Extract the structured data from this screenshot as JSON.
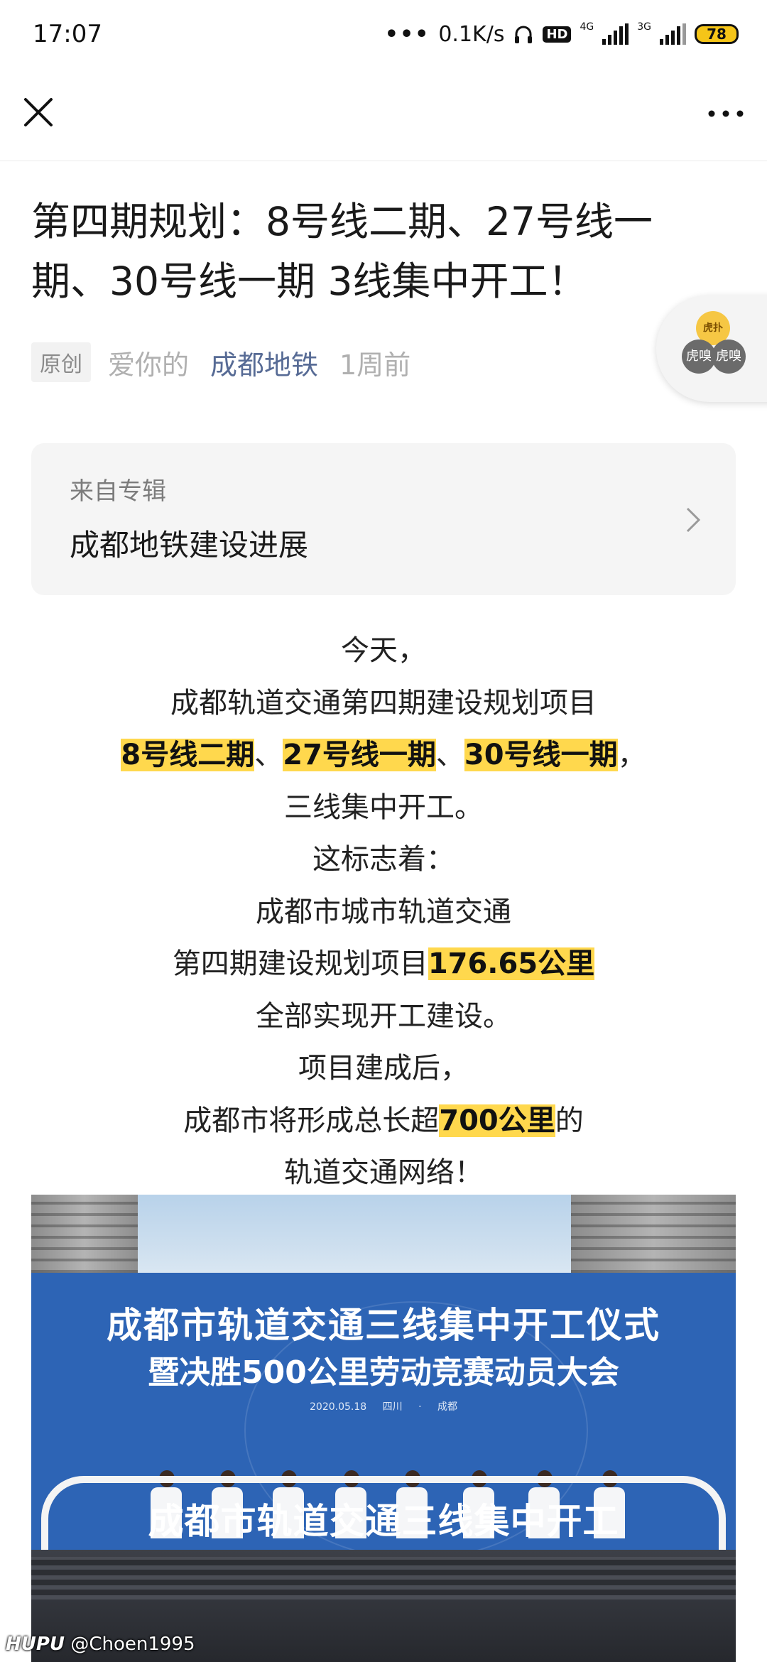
{
  "status_bar": {
    "time": "17:07",
    "speed": "0.1K/s",
    "hd": "HD",
    "net1": "4G",
    "net2": "3G",
    "battery": "78"
  },
  "nav": {
    "close_icon": "close-icon",
    "more_icon": "more-icon"
  },
  "article": {
    "title": "第四期规划：8号线二期、27号线一期、30号线一期 3线集中开工！",
    "tag": "原创",
    "author": "爱你的",
    "account": "成都地铁",
    "time": "1周前"
  },
  "floater": {
    "coin": "虎扑",
    "badge1": "虎嗅",
    "badge2": "虎嗅"
  },
  "album": {
    "label": "来自专辑",
    "name": "成都地铁建设进展"
  },
  "body": {
    "l1": "今天，",
    "l2": "成都轨道交通第四期建设规划项目",
    "l3_h1": "8号线二期",
    "l3_s1": "、",
    "l3_h2": "27号线一期",
    "l3_s2": "、",
    "l3_h3": "30号线一期",
    "l3_end": "，",
    "l4": "三线集中开工。",
    "l5": "这标志着：",
    "l6": "成都市城市轨道交通",
    "l7_pre": "第四期建设规划项目",
    "l7_hl": "176.65公里",
    "l8": "全部实现开工建设。",
    "l9": "项目建成后，",
    "l10_pre": "成都市将形成总长超",
    "l10_hl": "700公里",
    "l10_post": "的",
    "l11": "轨道交通网络！"
  },
  "photo": {
    "banner_title": "成都市轨道交通三线集中开工仪式",
    "banner_subtitle": "暨决胜500公里劳动竞赛动员大会",
    "banner_date": "2020.05.18 四川 · 成都",
    "stage_text": "成都市轨道交通三线集中开工"
  },
  "watermark": {
    "brand": "HUPU",
    "user": "@Choen1995"
  },
  "colors": {
    "highlight": "#ffd84d",
    "link": "#576b95",
    "banner": "#2d64b5"
  }
}
